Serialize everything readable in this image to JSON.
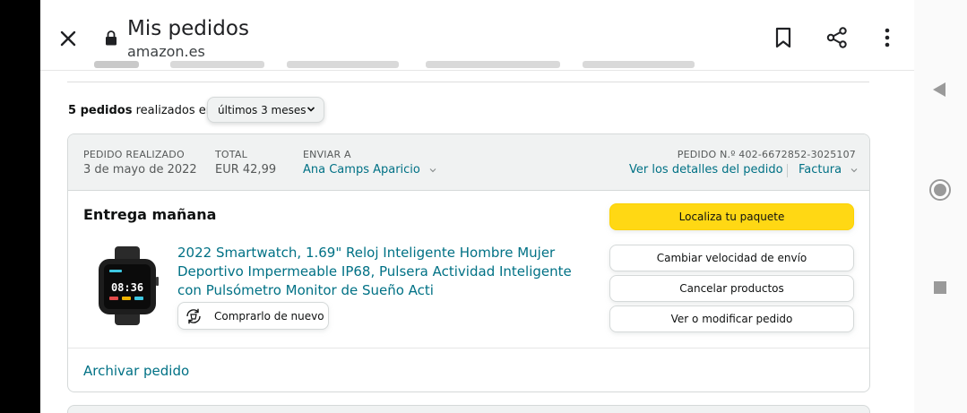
{
  "browser": {
    "title": "Mis pedidos",
    "url": "amazon.es",
    "icons": [
      "close-icon",
      "lock-icon",
      "bookmark-icon",
      "share-icon",
      "more-vert-icon"
    ]
  },
  "orders": {
    "count_bold": "5 pedidos",
    "count_rest": "realizados en",
    "range_selected": "últimos 3 meses"
  },
  "order": {
    "placed_label": "PEDIDO REALIZADO",
    "placed_value": "3 de mayo de 2022",
    "total_label": "TOTAL",
    "total_value": "EUR 42,99",
    "ship_label": "ENVIAR A",
    "ship_value": "Ana Camps Aparicio",
    "order_number": "PEDIDO N.º 402-6672852-3025107",
    "details_link": "Ver los detalles del pedido",
    "invoice_link": "Factura",
    "delivery_status": "Entrega mañana",
    "product_title": "2022 Smartwatch, 1.69\" Reloj Inteligente Hombre Mujer Deportivo Impermeable IP68, Pulsera Actividad Inteligente con Pulsómetro Monitor de Sueño Acti",
    "watch_screen_time": "08:36",
    "buy_again": "Comprarlo de nuevo",
    "archive": "Archivar pedido",
    "actions": {
      "track": "Localiza tu paquete",
      "change_speed": "Cambiar velocidad de envío",
      "cancel": "Cancelar productos",
      "view_modify": "Ver o modificar pedido"
    }
  },
  "colors": {
    "link": "#007185",
    "primary_button": "#FFD814",
    "header_bg": "#F0F2F2"
  }
}
